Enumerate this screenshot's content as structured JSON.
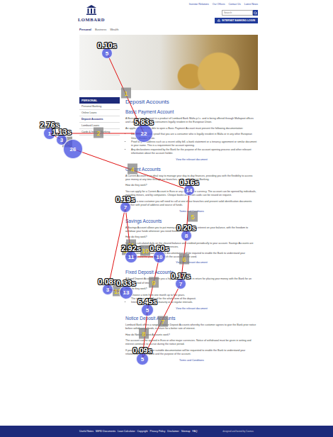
{
  "header": {
    "logo": "LOMBARD",
    "top_links": [
      "Investor Relations",
      "Our Offices",
      "Contact Us",
      "Latest News"
    ],
    "search": {
      "placeholder": "Search"
    },
    "login_button": "INTERNET BANKING LOGIN"
  },
  "nav": [
    {
      "label": "Personal",
      "selected": true
    },
    {
      "label": "Business",
      "selected": false
    },
    {
      "label": "Wealth",
      "selected": false
    }
  ],
  "sidebar": {
    "title": "PERSONAL",
    "items": [
      {
        "label": "Personal Banking",
        "selected": false
      },
      {
        "label": "Online Loans",
        "selected": false
      },
      {
        "label": "Deposit Accounts",
        "selected": true
      },
      {
        "label": "Lombard Loans",
        "selected": false
      },
      {
        "label": "Cards & Internet Banking",
        "selected": false
      }
    ]
  },
  "page": {
    "title": "Deposit Accounts",
    "sections": [
      {
        "title": "Basic Payment Account",
        "paragraphs": [
          "A Basic Payment Account is a product of Lombard Bank Malta p.l.c. and is being offered through Maltapost offices and Lombard branches to consumers legally resident in the European Union.",
          "An applicant who is eligible to open a Basic Payment Account must present the following documentation:"
        ],
        "bullets": [
          "Documents to show proof that you are a consumer who is legally resident in Malta or in any other European Union Member State.",
          "Proof of your address such as a recent utility bill, a bank statement or a tenancy agreement or similar document in your name. This is a requirement for account opening.",
          "Any declarations requested by the Bank for the purpose of the account opening process and other relevant information about the account holder."
        ],
        "link": "View the relevant document"
      },
      {
        "title": "Current Accounts",
        "paragraphs": [
          "A Current Account is an ideal way to manage your day-to-day finances, providing you with the flexibility to access your money at any time through our branches, cards and Internet Banking.",
          "How do they work?",
          "You can apply for a Current Account in Euro or any other major currency. The account can be opened by individuals, including minors, and by companies. Cheque books and debit cards can be issued on request.",
          "If you are a new customer you will need to call at one of our branches and present valid identification documents together with proof of address and source of funds."
        ],
        "bullets": [],
        "link": "Terms and Conditions"
      },
      {
        "title": "Savings Accounts",
        "paragraphs": [
          "A Savings Account allows you to put money aside while earning interest on your balance, with the freedom to withdraw your funds whenever you need them.",
          "How do they work?",
          "Interest is calculated daily on the cleared balance and credited periodically to your account. Savings Accounts are available in Euro and in other major currencies.",
          "Before opening an account, suitable documentation will be required to enable the Bank to understand your relationship and the purpose for which the account will be used."
        ],
        "bullets": [],
        "link": "View the relevant document"
      },
      {
        "title": "Fixed Deposit Accounts",
        "paragraphs": [
          "A Fixed Deposit Account offers you a higher rate of interest in return for placing your money with the Bank for an agreed period of time.",
          "How do they work?"
        ],
        "bullets": [
          "Choose a term from one month up to five years.",
          "The interest rate is fixed for the whole term of the deposit.",
          "Interest may be paid on maturity or at regular intervals."
        ],
        "link": "View the relevant document"
      },
      {
        "title": "Notice Deposit Accounts",
        "paragraphs": [
          "Lombard Bank offers a range of Notice Deposit Accounts whereby the customer agrees to give the Bank prior notice before withdrawing funds, in return for a better rate of interest.",
          "How do Notice Deposit Accounts work?",
          "The account can be opened in Euro or other major currencies. Notice of withdrawal must be given in writing and interest continues to accrue during the notice period.",
          "If you are a new customer suitable documentation will be requested to enable the Bank to understand your relationship with the Bank and the purpose of the account."
        ],
        "bullets": [],
        "link": "Terms and Conditions"
      }
    ]
  },
  "footer": {
    "links": [
      "Useful Notes",
      "MiFID Documents",
      "Loan Calculator",
      "Copyright",
      "Privacy Policy",
      "Disclaimer",
      "Sitemap",
      "FAQ"
    ],
    "credit": "designed and hosted by Cosmos"
  },
  "gaze": {
    "fixations": [
      {
        "number": "5",
        "duration": "0.10s"
      },
      {
        "number": "1",
        "duration": "2.76s"
      },
      {
        "number": "22",
        "duration": "5.83s"
      },
      {
        "number": "3",
        "duration": "1.13s"
      },
      {
        "number": "26",
        "duration": ""
      },
      {
        "number": "14",
        "duration": "0.16s"
      },
      {
        "number": "7",
        "duration": "0.19s"
      },
      {
        "number": "8",
        "duration": "0.20s"
      },
      {
        "number": "11",
        "duration": "2.92s"
      },
      {
        "number": "10",
        "duration": "0.60s"
      },
      {
        "number": "7",
        "duration": "0.17s"
      },
      {
        "number": "3",
        "duration": "0.08s"
      },
      {
        "number": "13",
        "duration": "0.33s"
      },
      {
        "number": "5",
        "duration": "6.45s"
      },
      {
        "number": "5",
        "duration": "0.09s"
      }
    ],
    "path_labels": [
      "1",
      "2",
      "3",
      "4",
      "5",
      "6",
      "7",
      "8",
      "9",
      "10",
      "11",
      "12",
      "13"
    ]
  }
}
